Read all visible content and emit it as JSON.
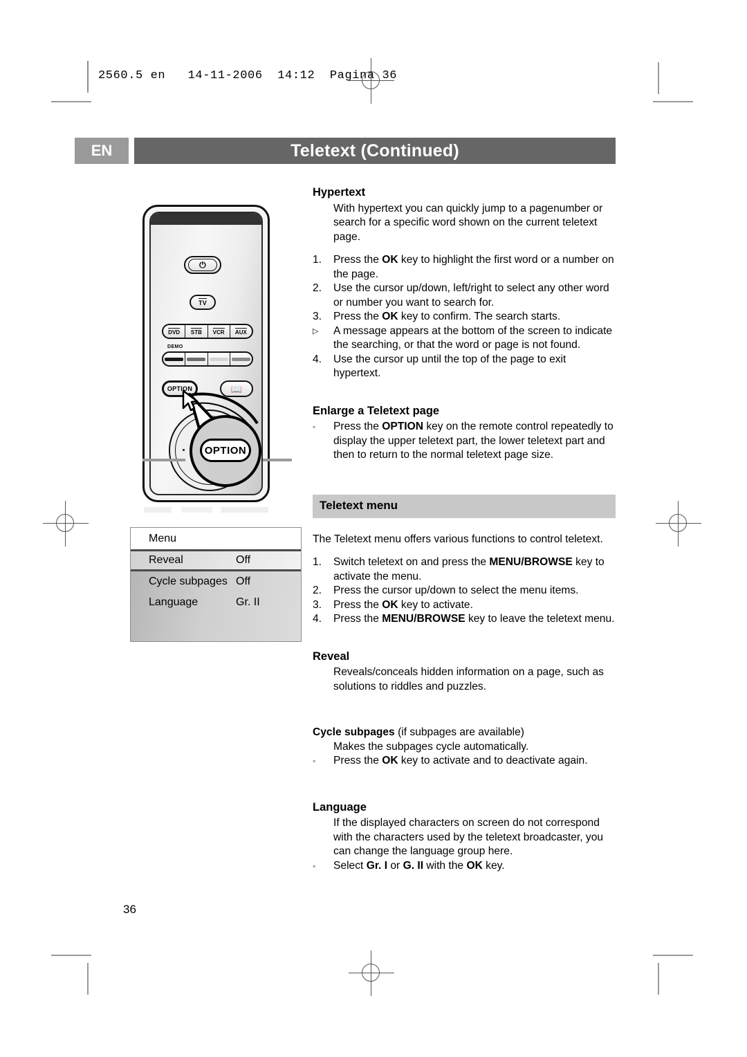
{
  "printer_slug": "2560.5 en   14-11-2006  14:12  Pagina 36",
  "header": {
    "language_code": "EN",
    "title": "Teletext  (Continued)"
  },
  "page_number": "36",
  "remote": {
    "power_button": "power-glyph",
    "tv_button": "TV",
    "source_buttons": [
      "DVD",
      "STB",
      "VCR",
      "AUX"
    ],
    "demo_label": "DEMO",
    "color_buttons": [
      "#1a1a1a",
      "#6e6e6e",
      "#d4d4d4",
      "#8a8a8a"
    ],
    "option_button": "OPTION",
    "book_button": "book-glyph",
    "callout_label": "OPTION"
  },
  "osd_menu": {
    "title": "Menu",
    "rows": [
      {
        "label": "Reveal",
        "value": "Off",
        "selected": true
      },
      {
        "label": "Cycle subpages",
        "value": "Off",
        "selected": false
      },
      {
        "label": "Language",
        "value": "Gr. II",
        "selected": false
      }
    ]
  },
  "hypertext": {
    "heading": "Hypertext",
    "intro": "With hypertext you can quickly jump to a pagenumber or search for a specific word shown on the current teletext page.",
    "steps": [
      {
        "marker": "1.",
        "text_parts": [
          "Press the ",
          "OK",
          " key to highlight the first word or a number on the page."
        ]
      },
      {
        "marker": "2.",
        "text_parts": [
          "Use the cursor up/down, left/right to select any other word or number you want to search for."
        ]
      },
      {
        "marker": "3.",
        "text_parts": [
          "Press the ",
          "OK",
          " key to confirm. The search starts."
        ]
      },
      {
        "marker": "▷",
        "text_parts": [
          "A message appears at the bottom of the screen to indicate the searching, or that the word or page is not found."
        ]
      },
      {
        "marker": "4.",
        "text_parts": [
          "Use the cursor up until the top of the page to exit hypertext."
        ]
      }
    ]
  },
  "enlarge": {
    "heading": "Enlarge a Teletext page",
    "bullet_marker": "◦",
    "bullet_parts": [
      "Press the ",
      "OPTION",
      " key on the remote control repeatedly to display the upper teletext part, the lower teletext part and then to return to the normal teletext page size."
    ]
  },
  "teletext_menu": {
    "bar_title": "Teletext menu",
    "intro": "The Teletext menu offers various functions to control teletext.",
    "steps": [
      {
        "marker": "1.",
        "text_parts": [
          "Switch teletext on and press the ",
          "MENU/BROWSE",
          " key to activate the menu."
        ]
      },
      {
        "marker": "2.",
        "text_parts": [
          "Press the cursor up/down to select the menu items."
        ]
      },
      {
        "marker": "3.",
        "text_parts": [
          "Press the ",
          "OK",
          " key to activate."
        ]
      },
      {
        "marker": "4.",
        "text_parts": [
          "Press the ",
          "MENU/BROWSE",
          " key to leave the teletext menu."
        ]
      }
    ]
  },
  "reveal": {
    "heading": "Reveal",
    "body": "Reveals/conceals hidden information on a page, such as solutions to riddles and puzzles."
  },
  "cycle_subpages": {
    "heading_bold": "Cycle subpages",
    "heading_rest": " (if subpages are available)",
    "body": "Makes the subpages cycle automatically.",
    "bullet_marker": "◦",
    "bullet_parts": [
      "Press the ",
      "OK",
      " key to activate and to deactivate again."
    ]
  },
  "language": {
    "heading": "Language",
    "body": "If the displayed characters on screen do not correspond with the characters used by the teletext broadcaster, you can change the language group here.",
    "bullet_marker": "◦",
    "bullet_parts": [
      "Select ",
      "Gr. I",
      " or ",
      "G. II",
      " with the ",
      "OK",
      " key."
    ]
  },
  "colors": {
    "header_bar": "#666666",
    "lang_box": "#9a9a9a",
    "section_bar": "#c8c8c8"
  }
}
